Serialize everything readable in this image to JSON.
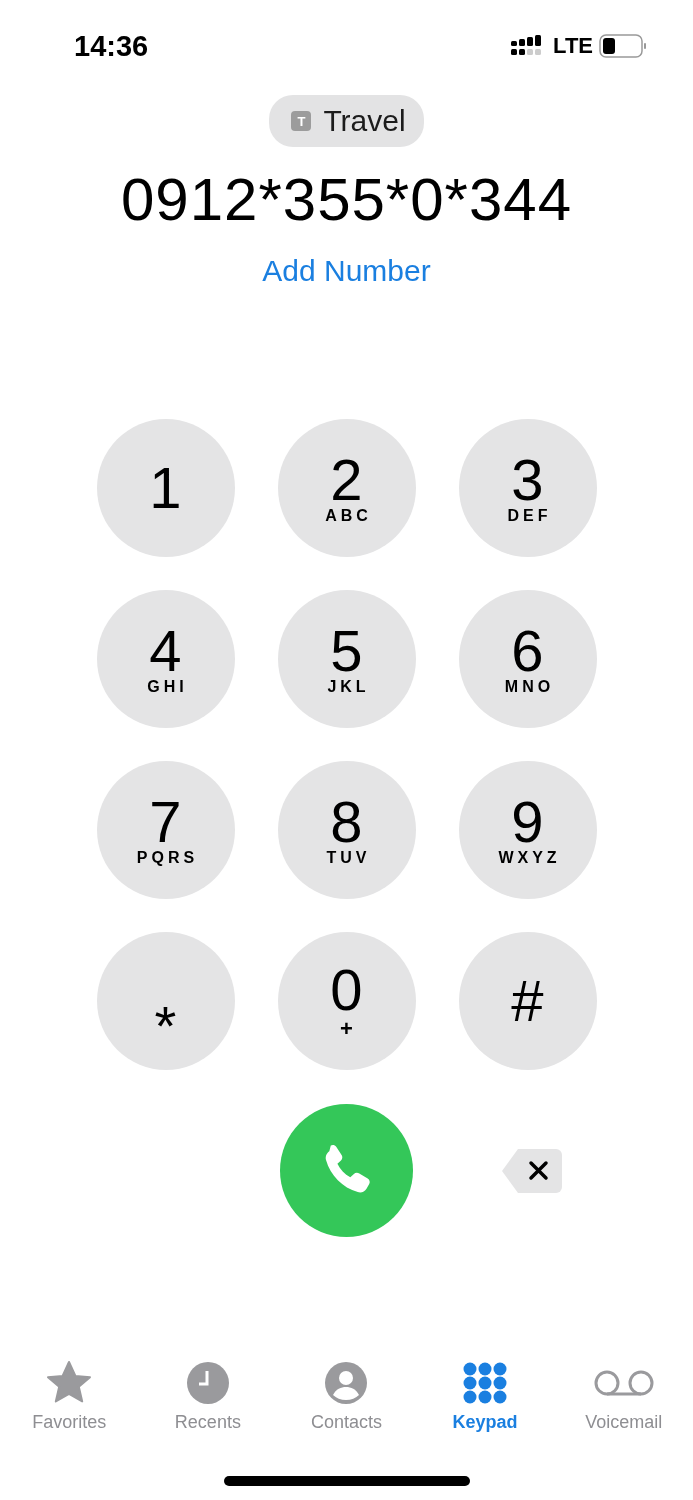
{
  "status_bar": {
    "time": "14:36",
    "network": "LTE"
  },
  "line_badge": {
    "icon_letter": "T",
    "label": "Travel"
  },
  "dialed_number": "0912*355*0*344",
  "add_number": "Add Number",
  "keys": [
    {
      "digit": "1"
    },
    {
      "digit": "2",
      "letters": "ABC"
    },
    {
      "digit": "3",
      "letters": "DEF"
    },
    {
      "digit": "4",
      "letters": "GHI"
    },
    {
      "digit": "5",
      "letters": "JKL"
    },
    {
      "digit": "6",
      "letters": "MNO"
    },
    {
      "digit": "7",
      "letters": "PQRS"
    },
    {
      "digit": "8",
      "letters": "TUV"
    },
    {
      "digit": "9",
      "letters": "WXYZ"
    },
    {
      "digit": "*"
    },
    {
      "digit": "0",
      "letters": "+"
    },
    {
      "digit": "#"
    }
  ],
  "tabs": [
    {
      "label": "Favorites",
      "selected": false
    },
    {
      "label": "Recents",
      "selected": false
    },
    {
      "label": "Contacts",
      "selected": false
    },
    {
      "label": "Keypad",
      "selected": true
    },
    {
      "label": "Voicemail",
      "selected": false
    }
  ]
}
